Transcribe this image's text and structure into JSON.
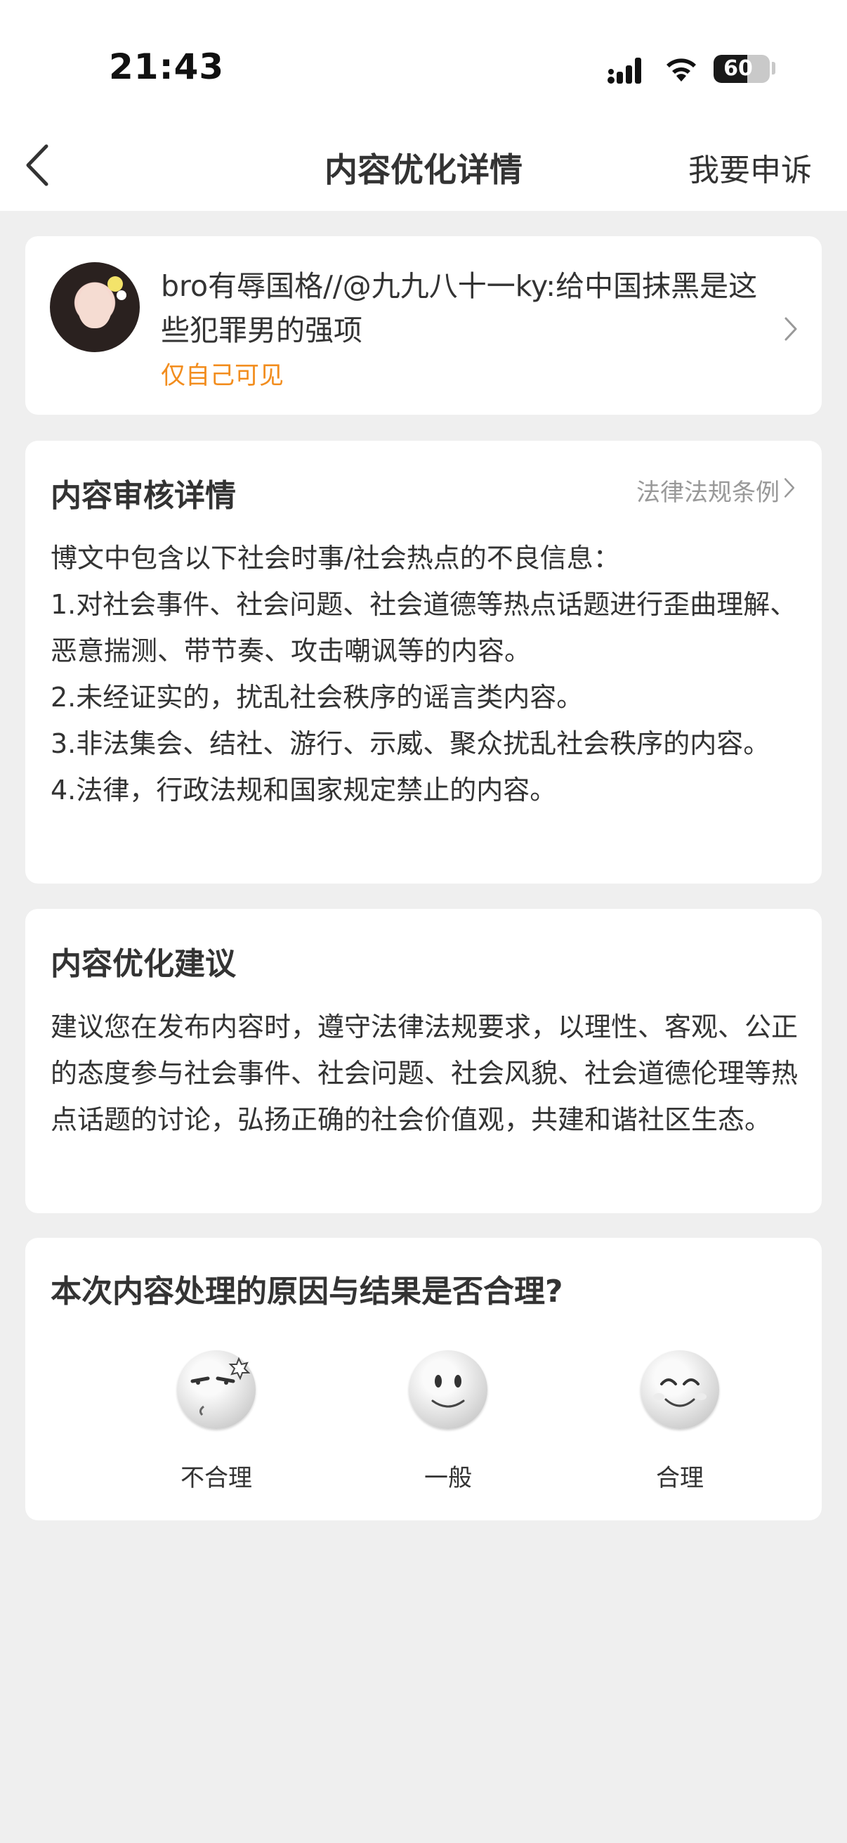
{
  "status_bar": {
    "time": "21:43",
    "battery": "60",
    "battery_level": 0.6
  },
  "header": {
    "title": "内容优化详情",
    "appeal": "我要申诉"
  },
  "post": {
    "text": "bro有辱国格//@九九八十一ky:给中国抹黑是这些犯罪男的强项",
    "visibility": "仅自己可见"
  },
  "review": {
    "title": "内容审核详情",
    "link": "法律法规条例",
    "lines": [
      "博文中包含以下社会时事/社会热点的不良信息：",
      "1.对社会事件、社会问题、社会道德等热点话题进行歪曲理解、恶意揣测、带节奏、攻击嘲讽等的内容。",
      "2.未经证实的，扰乱社会秩序的谣言类内容。",
      "3.非法集会、结社、游行、示威、聚众扰乱社会秩序的内容。",
      "4.法律，行政法规和国家规定禁止的内容。"
    ]
  },
  "suggestion": {
    "title": "内容优化建议",
    "body": "建议您在发布内容时，遵守法律法规要求，以理性、客观、公正的态度参与社会事件、社会问题、社会风貌、社会道德伦理等热点话题的讨论，弘扬正确的社会价值观，共建和谐社区生态。"
  },
  "feedback": {
    "question": "本次内容处理的原因与结果是否合理?",
    "options": [
      {
        "label": "不合理",
        "icon": "annoyed-face-icon"
      },
      {
        "label": "一般",
        "icon": "neutral-smile-icon"
      },
      {
        "label": "合理",
        "icon": "happy-face-icon"
      }
    ]
  }
}
